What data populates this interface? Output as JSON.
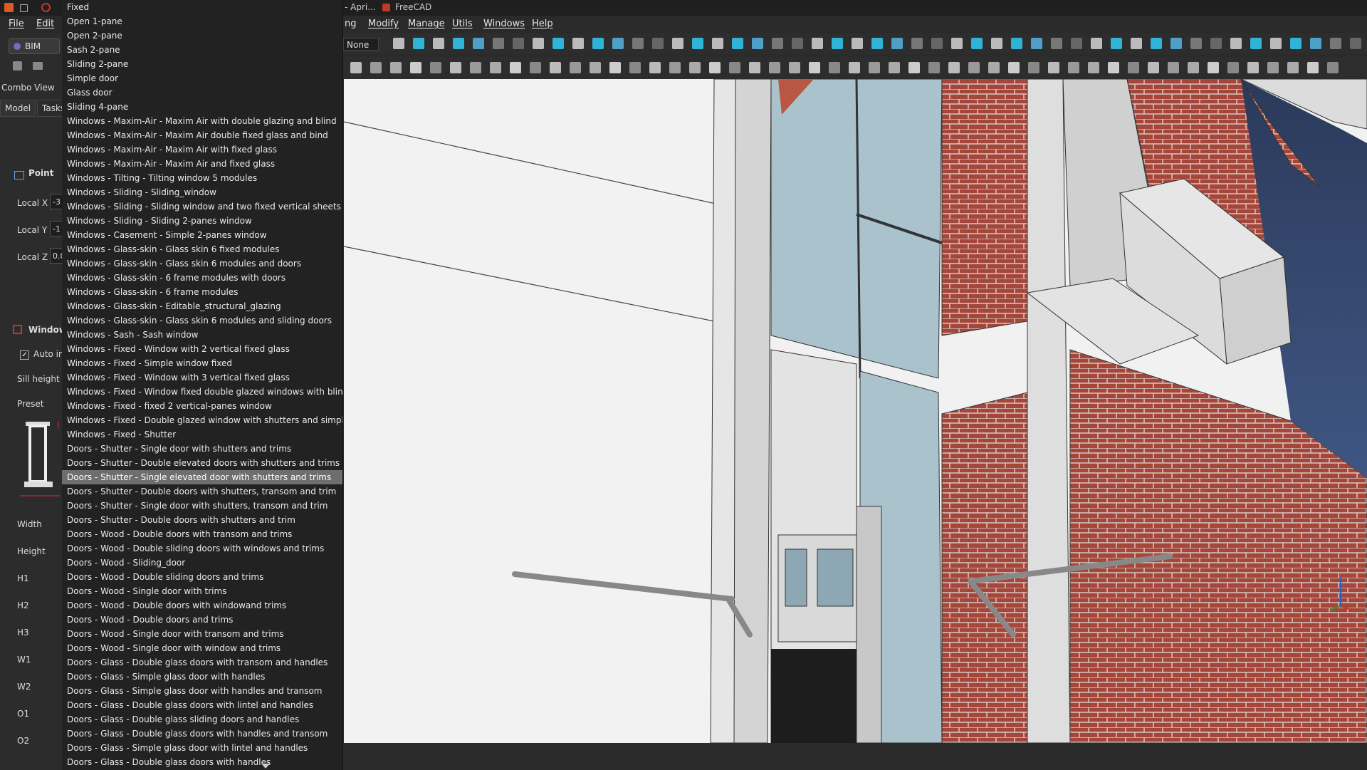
{
  "titlebar": {
    "doc_title": "- Apri...",
    "app_title": "FreeCAD"
  },
  "menus": {
    "file": "File",
    "edit": "Edit",
    "partial": "ng",
    "modify": "Modify",
    "manage": "Manage",
    "utils": "Utils",
    "windows": "Windows",
    "help": "Help"
  },
  "toolbar": {
    "snap_select_value": "None"
  },
  "left_panel": {
    "workbench": "BIM",
    "combo_view_title": "Combo View",
    "tabs": [
      "Model",
      "Tasks"
    ],
    "point_header": "Point",
    "local_x": "Local X",
    "local_x_value": "-3",
    "local_y": "Local Y",
    "local_y_value": "-1",
    "local_z": "Local Z",
    "local_z_value": "0.0",
    "window_header": "Window",
    "auto_include": "Auto in",
    "sill_height": "Sill height",
    "preset": "Preset",
    "params": [
      "Width",
      "Height",
      "H1",
      "H2",
      "H3",
      "W1",
      "W2",
      "O1",
      "O2"
    ]
  },
  "dropdown": {
    "selected_index": 33,
    "items": [
      "Fixed",
      "Open 1-pane",
      "Open 2-pane",
      "Sash 2-pane",
      "Sliding 2-pane",
      "Simple door",
      "Glass door",
      "Sliding 4-pane",
      "Windows - Maxim-Air - Maxim Air with double glazing and blind",
      "Windows - Maxim-Air - Maxim Air double fixed glass and bind",
      "Windows - Maxim-Air - Maxim Air with fixed glass",
      "Windows - Maxim-Air - Maxim Air and fixed glass",
      "Windows - Tilting - Tilting window 5 modules",
      "Windows - Sliding - Sliding_window",
      "Windows - Sliding - Sliding window and two fixed vertical sheets",
      "Windows - Sliding - Sliding 2-panes window",
      "Windows - Casement - Simple 2-panes window",
      "Windows - Glass-skin - Glass skin 6 fixed modules",
      "Windows - Glass-skin - Glass skin 6 modules and doors",
      "Windows - Glass-skin - 6 frame modules with doors",
      "Windows - Glass-skin - 6 frame modules",
      "Windows - Glass-skin - Editable_structural_glazing",
      "Windows - Glass-skin - Glass skin 6 modules and sliding doors",
      "Windows - Sash - Sash window",
      "Windows - Fixed - Window with 2 vertical fixed glass",
      "Windows - Fixed - Simple window fixed",
      "Windows - Fixed - Window with 3 vertical fixed glass",
      "Windows - Fixed - Window fixed double glazed windows with blind",
      "Windows - Fixed - fixed 2 vertical-panes window",
      "Windows - Fixed - Double glazed window with shutters and simple",
      "Windows - Fixed - Shutter",
      "Doors - Shutter - Single door with shutters and trims",
      "Doors - Shutter - Double elevated doors with shutters and trims",
      "Doors - Shutter - Single elevated door with shutters and trims",
      "Doors - Shutter - Double doors with shutters, transom and trim",
      "Doors - Shutter - Single door with shutters, transom and trim",
      "Doors - Shutter - Double doors with shutters and trim",
      "Doors - Wood - Double doors with transom and trims",
      "Doors - Wood - Double sliding doors with windows and trims",
      "Doors - Wood - Sliding_door",
      "Doors - Wood - Double sliding doors and trims",
      "Doors - Wood - Single door with trims",
      "Doors - Wood - Double doors with windowand trims",
      "Doors - Wood - Double doors and trims",
      "Doors - Wood - Single door with transom and trims",
      "Doors - Wood - Single door with window and trims",
      "Doors - Glass - Double glass doors with transom and handles",
      "Doors - Glass - Simple glass door with handles",
      "Doors - Glass - Simple glass door with handles and transom",
      "Doors - Glass - Double glass doors with lintel and handles",
      "Doors - Glass - Double glass sliding doors and handles",
      "Doors - Glass - Double glass doors with handles and transom",
      "Doors - Glass - Simple glass door with lintel and handles",
      "Doors - Glass - Double glass doors with handles"
    ]
  },
  "colors": {
    "brick": "#a5463a",
    "glass": "#9fb9c4",
    "wall": "#f1f1f1",
    "concrete": "#dcdcdc",
    "selected_item": "#6e6e6e"
  }
}
